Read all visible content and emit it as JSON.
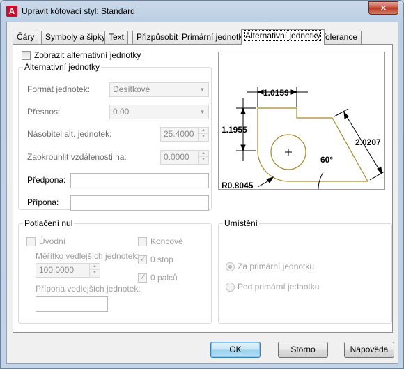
{
  "window": {
    "title": "Upravit kótovací styl: Standard",
    "close_symbol": "✕",
    "app_icon_letter": "A",
    "app_icon_name": "autocad-icon"
  },
  "tabs": [
    {
      "label": "Čáry",
      "active": false
    },
    {
      "label": "Symboly a šipky",
      "active": false
    },
    {
      "label": "Text",
      "active": false
    },
    {
      "label": "Přizpůsobit",
      "active": false
    },
    {
      "label": "Primární jednotky",
      "active": false
    },
    {
      "label": "Alternativní jednotky",
      "active": true
    },
    {
      "label": "Tolerance",
      "active": false
    }
  ],
  "show_alt": {
    "label": "Zobrazit alternativní jednotky",
    "checked": false
  },
  "alt_units": {
    "group_title": "Alternativní jednotky",
    "unit_format_label": "Formát jednotek:",
    "unit_format_value": "Desítkové",
    "precision_label": "Přesnost",
    "precision_value": "0.00",
    "multiplier_label": "Násobitel alt. jednotek:",
    "multiplier_value": "25.4000",
    "round_label": "Zaokrouhlit vzdálenosti na:",
    "round_value": "0.0000",
    "prefix_label": "Předpona:",
    "prefix_value": "",
    "suffix_label": "Přípona:",
    "suffix_value": ""
  },
  "zero_suppression": {
    "group_title": "Potlačení nul",
    "leading_label": "Úvodní",
    "leading_checked": false,
    "trailing_label": "Koncové",
    "trailing_checked": false,
    "sub_factor_label": "Měřítko vedlejších jednotek:",
    "sub_factor_value": "100.0000",
    "zero_feet_label": "0 stop",
    "zero_feet_checked": true,
    "zero_inches_label": "0 palců",
    "zero_inches_checked": true,
    "sub_suffix_label": "Přípona vedlejších jednotek:",
    "sub_suffix_value": ""
  },
  "placement": {
    "group_title": "Umístění",
    "after_label": "Za primární jednotku",
    "after_checked": true,
    "below_label": "Pod primární jednotku",
    "below_checked": false
  },
  "preview": {
    "dim_top": "1.0159",
    "dim_left": "1.1955",
    "dim_diag": "2.0207",
    "angle": "60°",
    "radius": "R0.8045",
    "line_color": "#a58a2c"
  },
  "buttons": {
    "ok": "OK",
    "cancel": "Storno",
    "help": "Nápověda"
  }
}
